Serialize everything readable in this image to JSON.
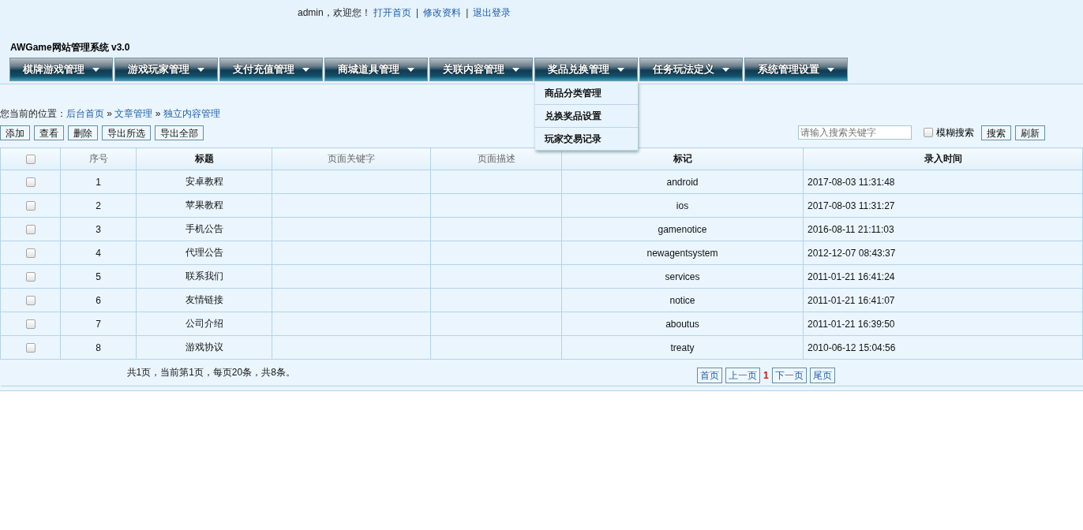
{
  "top_bar": {
    "greeting": "admin，欢迎您！",
    "links": [
      "打开首页",
      "修改资料",
      "退出登录"
    ],
    "separators": [
      "|",
      "|"
    ]
  },
  "title": "AWGame网站管理系统 v3.0",
  "menu": [
    {
      "label": "棋牌游戏管理"
    },
    {
      "label": "游戏玩家管理"
    },
    {
      "label": "支付充值管理"
    },
    {
      "label": "商城道具管理"
    },
    {
      "label": "关联内容管理"
    },
    {
      "label": "奖品兑换管理",
      "submenu": [
        "商品分类管理",
        "兑换奖品设置",
        "玩家交易记录"
      ]
    },
    {
      "label": "任务玩法定义"
    },
    {
      "label": "系统管理设置"
    }
  ],
  "breadcrumb": {
    "prefix": "您当前的位置：",
    "items": [
      "后台首页",
      "文章管理",
      "独立内容管理"
    ],
    "separators": [
      "»",
      "»"
    ]
  },
  "toolbar": {
    "buttons": [
      "添加",
      "查看",
      "删除",
      "导出所选",
      "导出全部"
    ],
    "search": {
      "placeholder": "请输入搜索关键字"
    },
    "fuzzy": {
      "label": "模糊搜索",
      "checked": false
    },
    "actions": [
      "搜索",
      "刷新"
    ]
  },
  "table": {
    "select_all": false,
    "columns": [
      {
        "label": "序号",
        "emphasized": false
      },
      {
        "label": "标题",
        "emphasized": true
      },
      {
        "label": "页面关键字",
        "emphasized": false
      },
      {
        "label": "页面描述",
        "emphasized": false
      },
      {
        "label": "标记",
        "emphasized": true
      },
      {
        "label": "录入时间",
        "emphasized": true
      }
    ],
    "rows": [
      {
        "checked": false,
        "cells": [
          "1",
          "安卓教程",
          "",
          "",
          "android",
          "2017-08-03 11:31:48"
        ]
      },
      {
        "checked": false,
        "cells": [
          "2",
          "苹果教程",
          "",
          "",
          "ios",
          "2017-08-03 11:31:27"
        ]
      },
      {
        "checked": false,
        "cells": [
          "3",
          "手机公告",
          "",
          "",
          "gamenotice",
          "2016-08-11 21:11:03"
        ]
      },
      {
        "checked": false,
        "cells": [
          "4",
          "代理公告",
          "",
          "",
          "newagentsystem",
          "2012-12-07 08:43:37"
        ]
      },
      {
        "checked": false,
        "cells": [
          "5",
          "联系我们",
          "",
          "",
          "services",
          "2011-01-21 16:41:24"
        ]
      },
      {
        "checked": false,
        "cells": [
          "6",
          "友情链接",
          "",
          "",
          "notice",
          "2011-01-21 16:41:07"
        ]
      },
      {
        "checked": false,
        "cells": [
          "7",
          "公司介绍",
          "",
          "",
          "aboutus",
          "2011-01-21 16:39:50"
        ]
      },
      {
        "checked": false,
        "cells": [
          "8",
          "游戏协议",
          "",
          "",
          "treaty",
          "2010-06-12 15:04:56"
        ]
      }
    ]
  },
  "pagination": {
    "summary": "共1页，当前第1页，每页20条，共8条。",
    "first": "首页",
    "prev": "上一页",
    "current": "1",
    "next": "下一页",
    "last": "尾页"
  }
}
